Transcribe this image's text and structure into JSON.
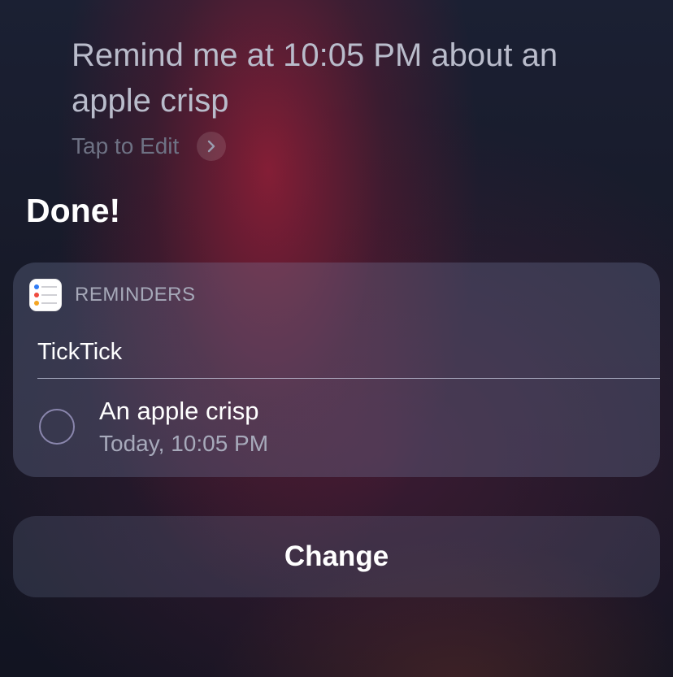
{
  "siri": {
    "query": "Remind me at 10:05 PM about an apple crisp",
    "tap_to_edit": "Tap to Edit",
    "response": "Done!"
  },
  "card": {
    "app_name": "REMINDERS",
    "app_icon": "reminders-app-icon",
    "list_name": "TickTick",
    "reminder": {
      "title": "An apple crisp",
      "due": "Today, 10:05 PM",
      "completed": false
    }
  },
  "actions": {
    "change_label": "Change"
  }
}
